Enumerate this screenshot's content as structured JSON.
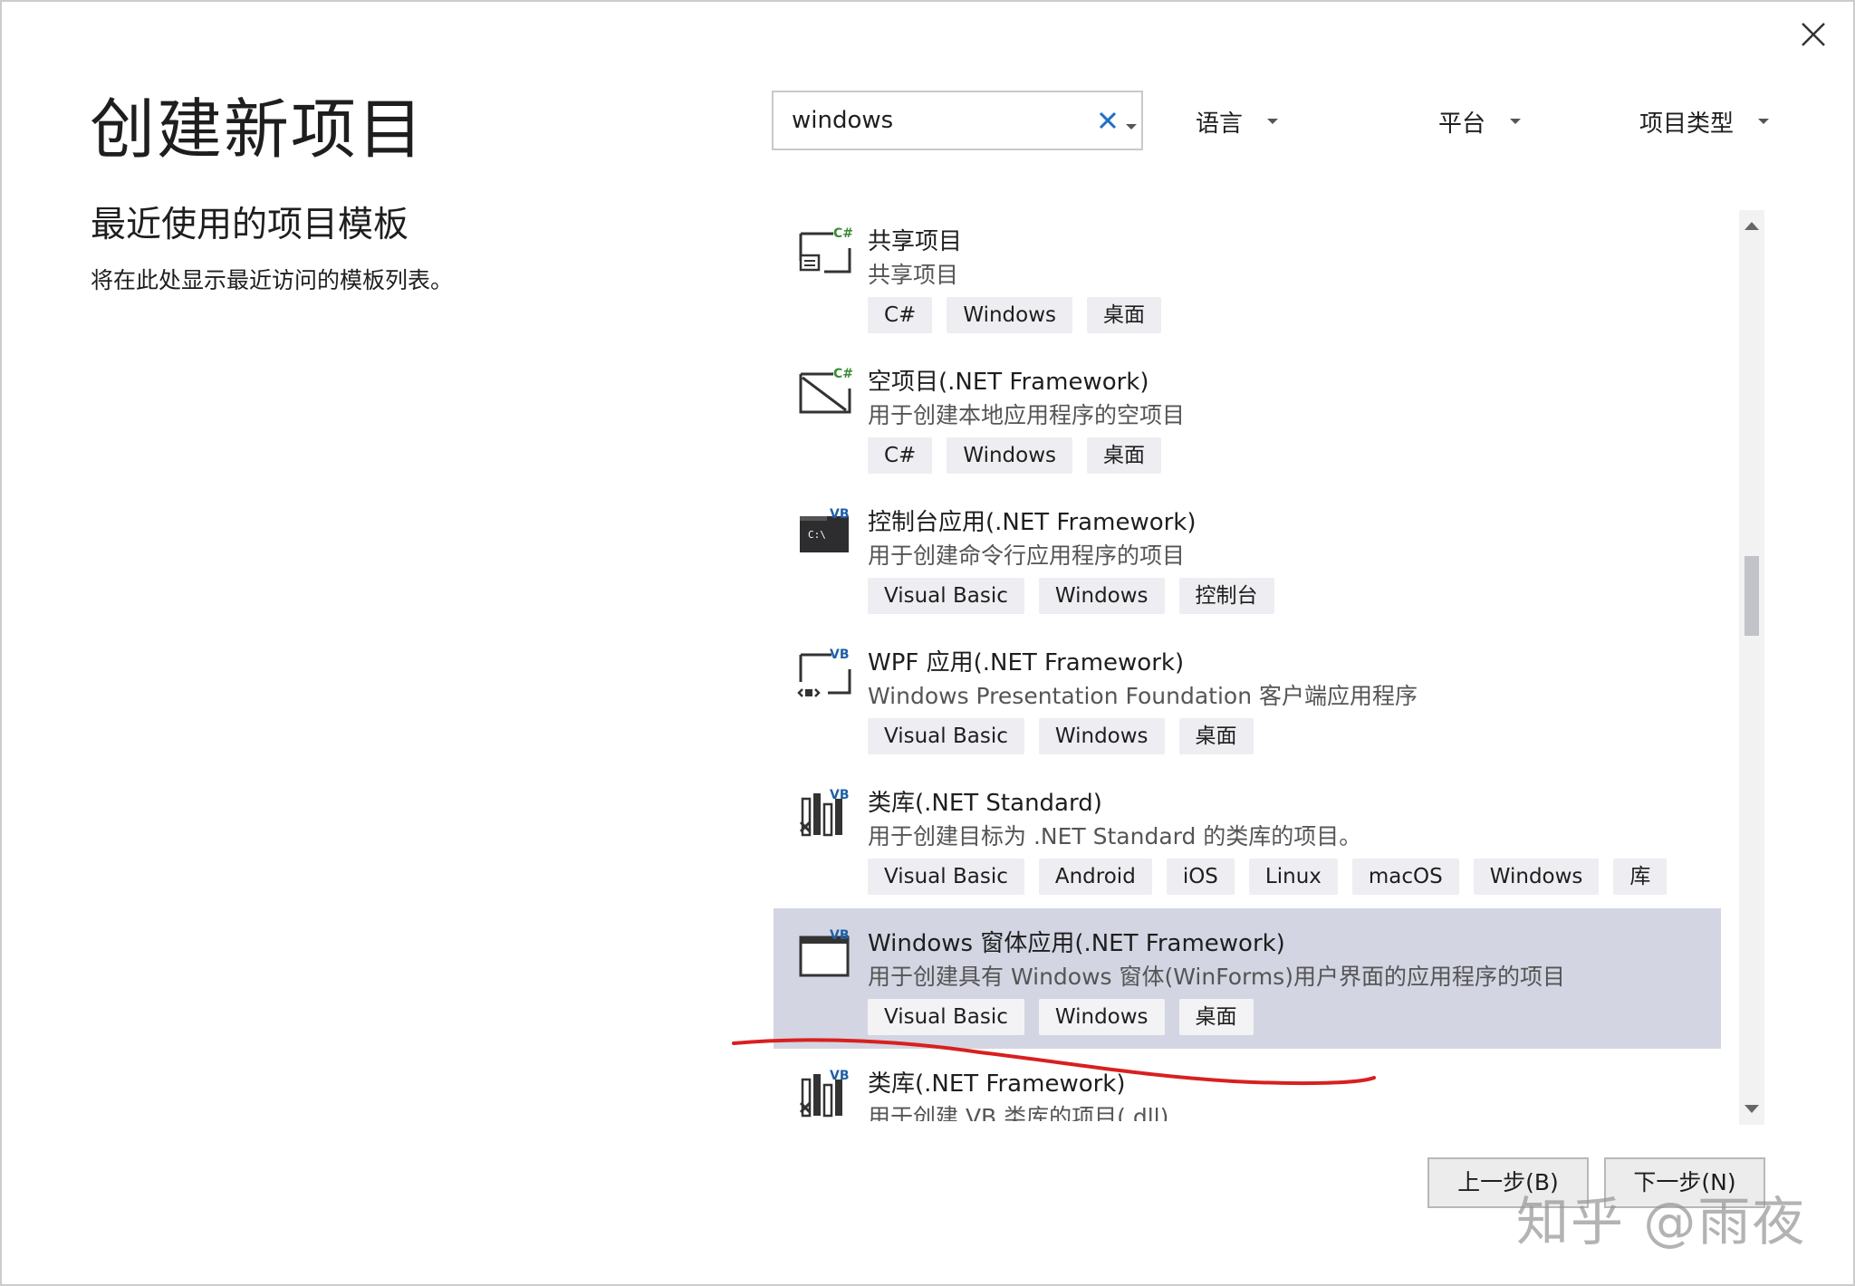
{
  "window": {
    "close_icon": "close-icon"
  },
  "header": {
    "title": "创建新项目"
  },
  "recent": {
    "title": "最近使用的项目模板",
    "description": "将在此处显示最近访问的模板列表。"
  },
  "search": {
    "value": "windows",
    "clear_icon": "x-icon",
    "dropdown_icon": "chevron-down-icon"
  },
  "filters": {
    "language": "语言",
    "platform": "平台",
    "project_type": "项目类型"
  },
  "templates": [
    {
      "title": "共享项目",
      "desc": "共享项目",
      "lang_badge": "C#",
      "tags": [
        "C#",
        "Windows",
        "桌面"
      ],
      "selected": false
    },
    {
      "title": "空项目(.NET Framework)",
      "desc": "用于创建本地应用程序的空项目",
      "lang_badge": "C#",
      "tags": [
        "C#",
        "Windows",
        "桌面"
      ],
      "selected": false
    },
    {
      "title": "控制台应用(.NET Framework)",
      "desc": "用于创建命令行应用程序的项目",
      "lang_badge": "VB",
      "icon_text": "C:\\",
      "tags": [
        "Visual Basic",
        "Windows",
        "控制台"
      ],
      "selected": false
    },
    {
      "title": "WPF 应用(.NET Framework)",
      "desc": "Windows Presentation Foundation 客户端应用程序",
      "lang_badge": "VB",
      "tags": [
        "Visual Basic",
        "Windows",
        "桌面"
      ],
      "selected": false
    },
    {
      "title": "类库(.NET Standard)",
      "desc": "用于创建目标为 .NET Standard 的类库的项目。",
      "lang_badge": "VB",
      "tags": [
        "Visual Basic",
        "Android",
        "iOS",
        "Linux",
        "macOS",
        "Windows",
        "库"
      ],
      "selected": false
    },
    {
      "title": "Windows 窗体应用(.NET Framework)",
      "desc": "用于创建具有 Windows 窗体(WinForms)用户界面的应用程序的项目",
      "lang_badge": "VB",
      "tags": [
        "Visual Basic",
        "Windows",
        "桌面"
      ],
      "selected": true
    },
    {
      "title": "类库(.NET Framework)",
      "desc": "用于创建 VB 类库的项目(.dll)",
      "lang_badge": "VB",
      "tags": [],
      "selected": false
    }
  ],
  "buttons": {
    "back": "上一步(B)",
    "next": "下一步(N)"
  },
  "watermark": "知乎 @雨夜",
  "colors": {
    "selected_row": "#d3d5e2",
    "tag_bg": "#eeeef2",
    "csharp_badge": "#388a34",
    "vb_badge": "#1f5fa8",
    "annotation": "#d8201f",
    "clear_x": "#1e6fc7"
  }
}
